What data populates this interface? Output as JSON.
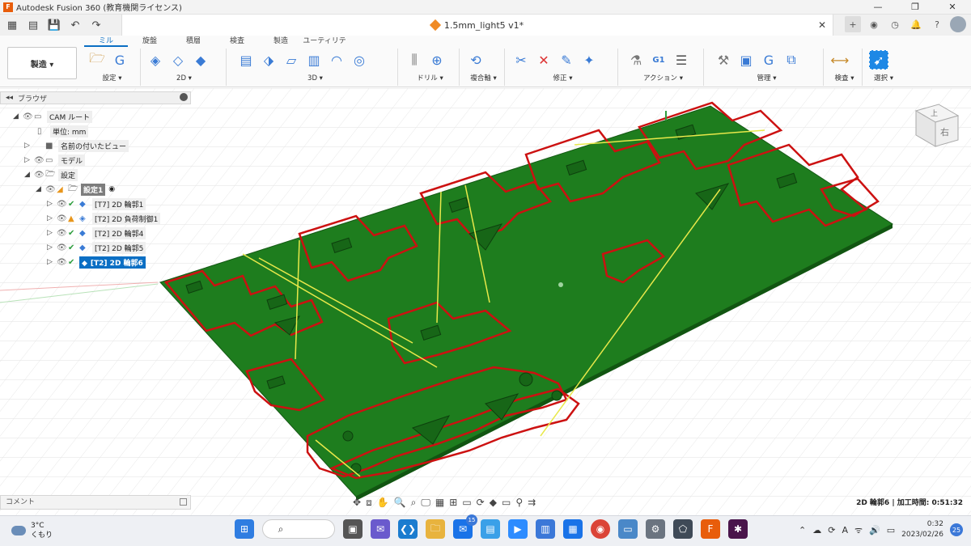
{
  "window": {
    "title": "Autodesk Fusion 360 (教育機関ライセンス)",
    "doc_tab": "1.5mm_light5 v1*"
  },
  "ribbon": {
    "tabs": [
      "ミル",
      "旋盤",
      "積層",
      "検査",
      "製造",
      "ユーティリティ"
    ],
    "workspace": "製造 ▾",
    "groups": [
      {
        "label": "設定 ▾"
      },
      {
        "label": "2D ▾"
      },
      {
        "label": "3D ▾"
      },
      {
        "label": "ドリル ▾"
      },
      {
        "label": "複合軸 ▾"
      },
      {
        "label": "修正 ▾"
      },
      {
        "label": "アクション ▾"
      },
      {
        "label": "管理 ▾"
      },
      {
        "label": "検査 ▾"
      },
      {
        "label": "選択 ▾"
      }
    ]
  },
  "browser": {
    "header": "ブラウザ",
    "items": [
      {
        "label": "CAM ルート"
      },
      {
        "label": "単位: mm"
      },
      {
        "label": "名前の付いたビュー"
      },
      {
        "label": "モデル"
      },
      {
        "label": "設定"
      },
      {
        "label": "設定1"
      },
      {
        "label": "[T7] 2D 輪郭1"
      },
      {
        "label": "[T2] 2D 負荷制御1"
      },
      {
        "label": "[T2] 2D 輪郭4"
      },
      {
        "label": "[T2] 2D 輪郭5"
      },
      {
        "label": "[T2] 2D 輪郭6"
      }
    ]
  },
  "viewcube": {
    "face": "右",
    "top": "上"
  },
  "comment": {
    "label": "コメント"
  },
  "status": {
    "text": "2D 輪郭6 | 加工時間: 0:51:32"
  },
  "taskbar": {
    "weather_temp": "3°C",
    "weather_desc": "くもり",
    "search": "検索",
    "mail_badge": "15",
    "ime": "A",
    "time": "0:32",
    "date": "2023/02/26",
    "notif_count": "25"
  },
  "colors": {
    "plate": "#1e7d1e",
    "outline": "#cc1111",
    "toolpath": "#e8e84a",
    "accent": "#0b6fc4"
  }
}
